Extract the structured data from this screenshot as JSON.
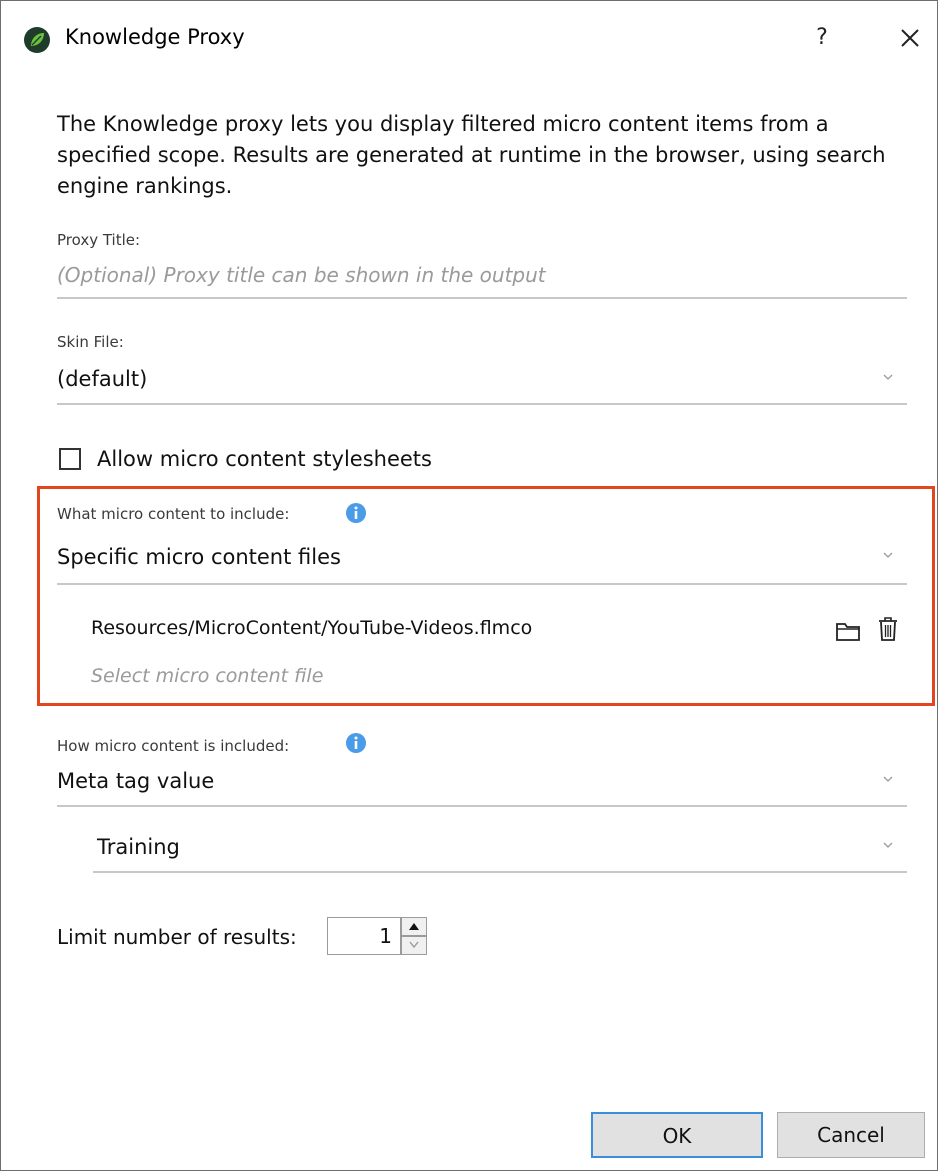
{
  "window": {
    "title": "Knowledge Proxy",
    "help_label": "?",
    "icons": {
      "app": "leaf-logo-icon",
      "close": "close-icon"
    }
  },
  "description": "The Knowledge proxy lets you display filtered micro content items from a specified scope. Results are generated at runtime in the browser, using search engine rankings.",
  "proxy_title": {
    "label": "Proxy Title:",
    "placeholder": "(Optional) Proxy title can be shown in the output",
    "value": ""
  },
  "skin_file": {
    "label": "Skin File:",
    "value": "(default)"
  },
  "allow_stylesheets": {
    "label": "Allow micro content stylesheets",
    "checked": false
  },
  "what_to_include": {
    "label": "What micro content to include:",
    "value": "Specific micro content files",
    "files": [
      "Resources/MicroContent/YouTube-Videos.flmco"
    ],
    "select_placeholder": "Select micro content file",
    "icons": [
      "info-icon",
      "folder-icon",
      "trash-icon"
    ]
  },
  "how_included": {
    "label": "How micro content is included:",
    "value": "Meta tag value",
    "sub_value": "Training"
  },
  "limit": {
    "label": "Limit number of results:",
    "value": "1"
  },
  "buttons": {
    "ok": "OK",
    "cancel": "Cancel"
  },
  "colors": {
    "highlight_border": "#e2461f",
    "info_blue": "#4a9be8",
    "ok_focus_border": "#3a8fd8",
    "logo_green": "#5aa832"
  }
}
